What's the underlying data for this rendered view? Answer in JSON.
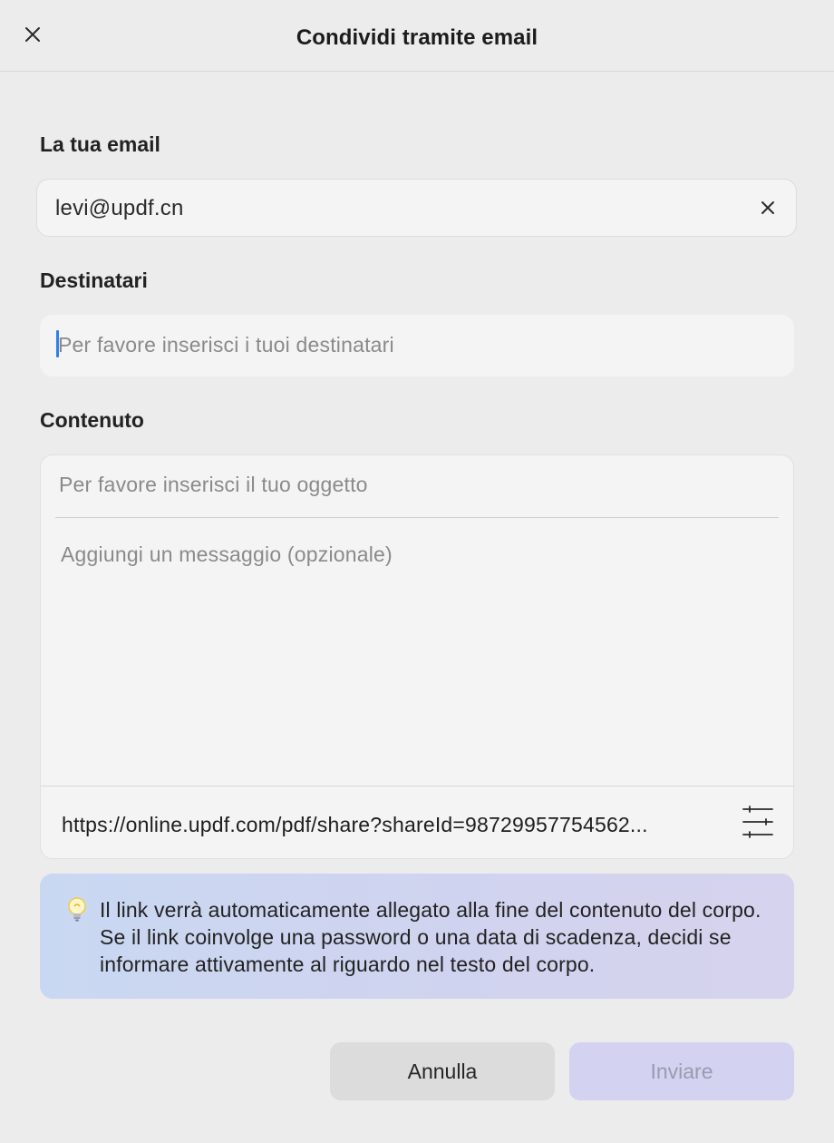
{
  "header": {
    "title": "Condividi tramite email",
    "close_icon": "close-icon"
  },
  "email_section": {
    "label": "La tua email",
    "value": "levi@updf.cn",
    "clear_icon": "clear-icon"
  },
  "recipients_section": {
    "label": "Destinatari",
    "placeholder": "Per favore inserisci i tuoi destinatari"
  },
  "content_section": {
    "label": "Contenuto",
    "subject_placeholder": "Per favore inserisci il tuo oggetto",
    "message_placeholder": "Aggiungi un messaggio (opzionale)",
    "share_link": "https://online.updf.com/pdf/share?shareId=98729957754562...",
    "settings_icon": "sliders-icon"
  },
  "info": {
    "icon": "lightbulb-icon",
    "text": "Il link verrà automaticamente allegato alla fine del contenuto del corpo. Se il link coinvolge una password o una data di scadenza, decidi se informare attivamente al riguardo nel testo del corpo."
  },
  "buttons": {
    "cancel_label": "Annulla",
    "send_label": "Inviare"
  },
  "colors": {
    "background": "#ececec",
    "field": "#f4f4f4",
    "caret": "#2f7ff0",
    "info_gradient_start": "#c9d8f2",
    "info_gradient_end": "#d6d3ee",
    "send_disabled": "#d3d2f0"
  }
}
